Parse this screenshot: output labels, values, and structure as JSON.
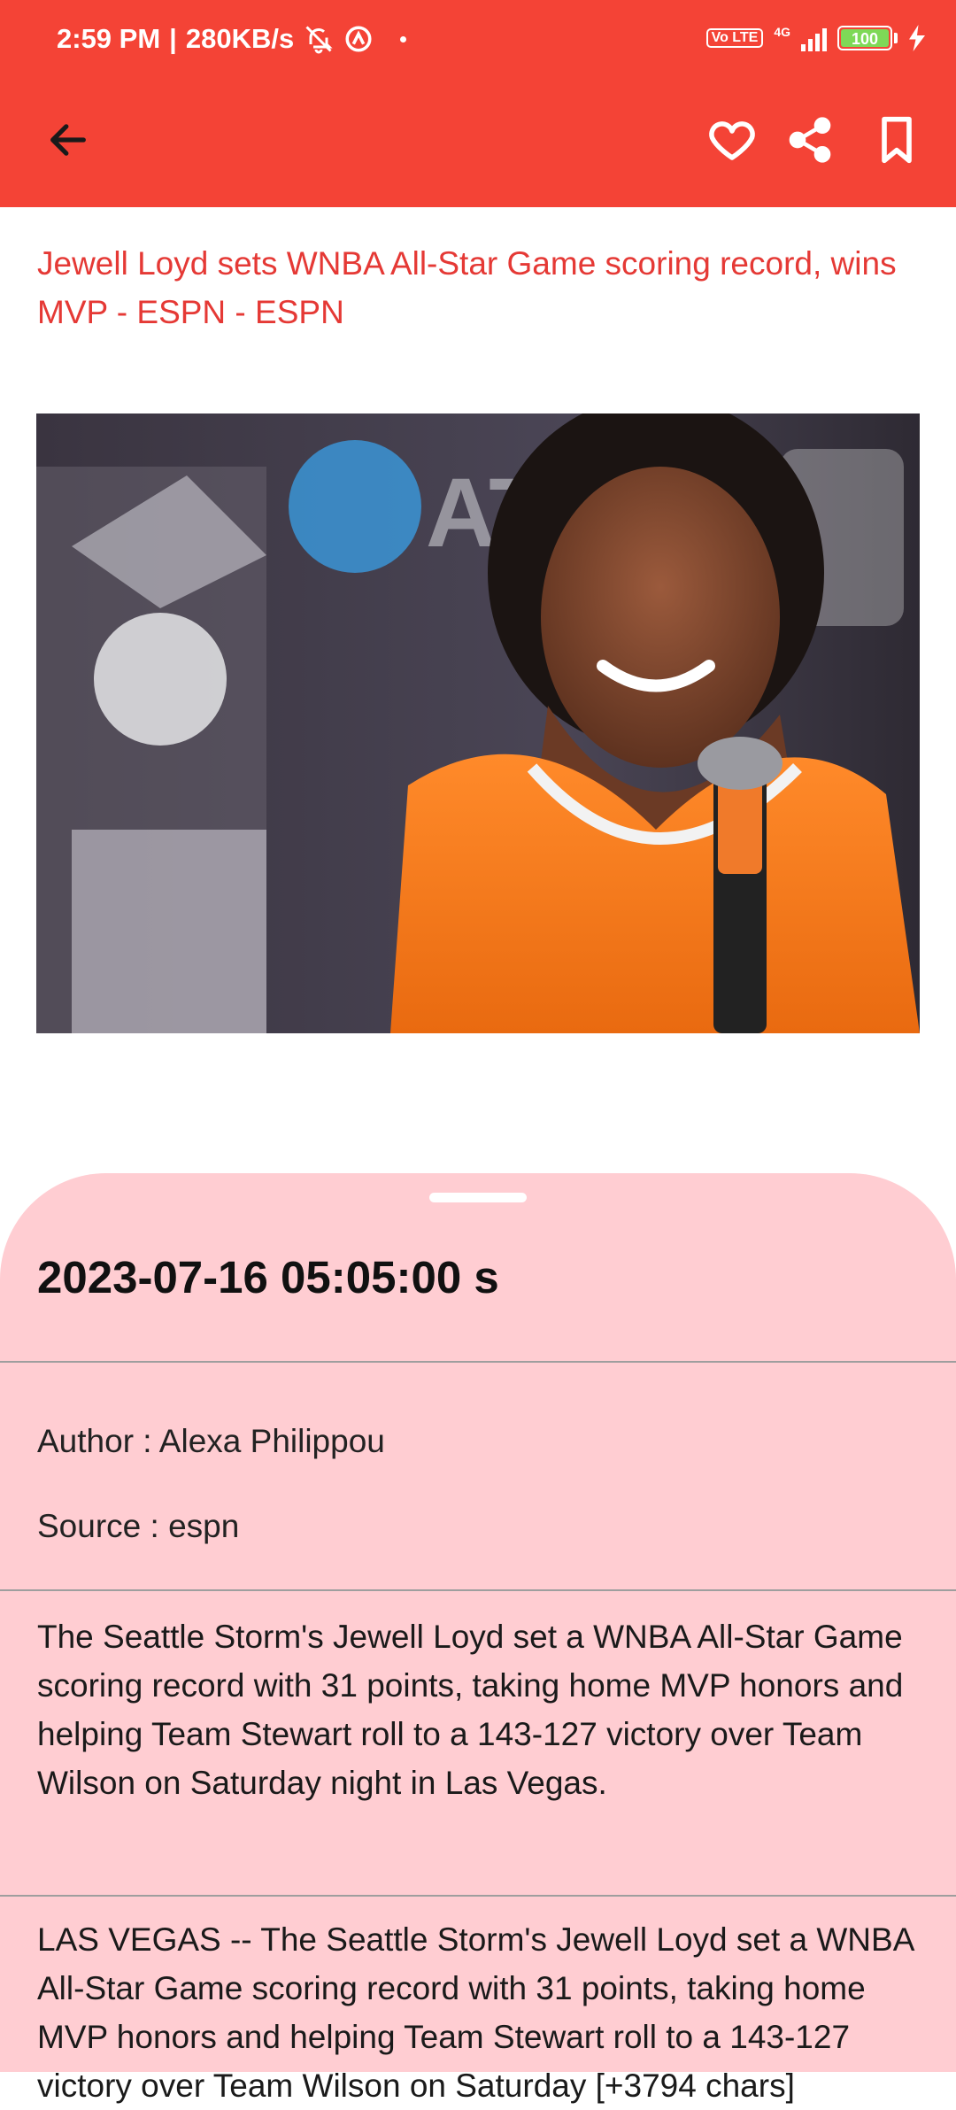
{
  "status_bar": {
    "time": "2:59 PM",
    "net_speed": "280KB/s",
    "network_badge": "Vo LTE",
    "network_type": "4G",
    "battery": "100",
    "icons": [
      "mute-bell-icon",
      "circle-a-icon",
      "dot-icon",
      "signal-icon",
      "battery-icon",
      "charging-bolt-icon"
    ]
  },
  "toolbar": {
    "color": "#f44336",
    "back_icon": "arrow-left-icon",
    "actions": [
      "heart-icon",
      "share-icon",
      "bookmark-icon"
    ]
  },
  "article": {
    "title": "Jewell Loyd sets WNBA All-Star Game scoring record, wins MVP - ESPN - ESPN",
    "image_alt": "Player smiling at press conference with microphone and trophy",
    "date": "2023-07-16  05:05:00 s",
    "author": "Author : Alexa Philippou",
    "source": "Source : espn",
    "summary": "The Seattle Storm's Jewell Loyd set a WNBA All-Star Game scoring record with 31 points, taking home MVP honors and helping Team Stewart roll to a 143-127 victory over Team Wilson on Saturday night in Las Vegas.",
    "body": "LAS VEGAS -- The Seattle Storm's Jewell Loyd set a WNBA All-Star Game scoring record with 31 points, taking home MVP honors and helping Team Stewart roll to a 143-127 victory over Team Wilson on Saturday [+3794 chars]"
  },
  "colors": {
    "accent": "#f44336",
    "title": "#e53935",
    "sheet": "#ffcdd2"
  }
}
